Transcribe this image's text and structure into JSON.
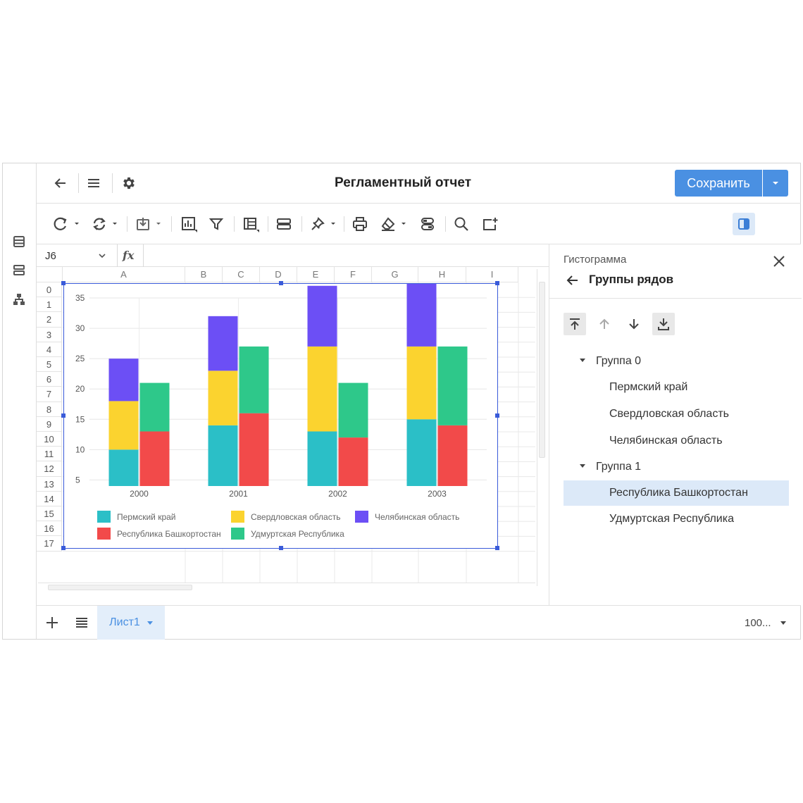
{
  "header": {
    "title": "Регламентный отчет",
    "save_label": "Сохранить"
  },
  "formula": {
    "cell_ref": "J6",
    "fx_label": "fx"
  },
  "columns": [
    "A",
    "B",
    "C",
    "D",
    "E",
    "F",
    "G",
    "H",
    "I"
  ],
  "rows": [
    "0",
    "1",
    "2",
    "3",
    "4",
    "5",
    "6",
    "7",
    "8",
    "9",
    "10",
    "11",
    "12",
    "13",
    "14",
    "15",
    "16",
    "17"
  ],
  "side_panel": {
    "section": "Гистограмма",
    "title": "Группы рядов",
    "tree": [
      {
        "label": "Группа 0",
        "type": "group"
      },
      {
        "label": "Пермский край",
        "type": "item"
      },
      {
        "label": "Свердловская область",
        "type": "item"
      },
      {
        "label": "Челябинская область",
        "type": "item"
      },
      {
        "label": "Группа 1",
        "type": "group"
      },
      {
        "label": "Республика Башкортостан",
        "type": "item",
        "selected": true
      },
      {
        "label": "Удмуртская Республика",
        "type": "item"
      }
    ]
  },
  "bottom": {
    "sheet_tab": "Лист1",
    "zoom": "100..."
  },
  "chart_data": {
    "type": "bar",
    "stacked": true,
    "categories": [
      "2000",
      "2001",
      "2002",
      "2003"
    ],
    "yticks": [
      5,
      10,
      15,
      20,
      25,
      30,
      35
    ],
    "ylim": [
      4,
      35
    ],
    "groups": [
      {
        "series": [
          {
            "name": "Пермский край",
            "color": "#2bbfc7",
            "values": [
              6,
              10,
              9,
              11
            ]
          },
          {
            "name": "Свердловская область",
            "color": "#fbd32f",
            "values": [
              8,
              9,
              14,
              12
            ]
          },
          {
            "name": "Челябинская область",
            "color": "#6c4ff5",
            "values": [
              7,
              9,
              10,
              11
            ]
          }
        ]
      },
      {
        "series": [
          {
            "name": "Республика Башкортостан",
            "color": "#f24a4a",
            "values": [
              9,
              12,
              8,
              10
            ]
          },
          {
            "name": "Удмуртская Республика",
            "color": "#2ec88a",
            "values": [
              8,
              11,
              9,
              13
            ]
          }
        ]
      }
    ],
    "legend": [
      {
        "name": "Пермский край",
        "color": "#2bbfc7"
      },
      {
        "name": "Свердловская область",
        "color": "#fbd32f"
      },
      {
        "name": "Челябинская область",
        "color": "#6c4ff5"
      },
      {
        "name": "Республика Башкортостан",
        "color": "#f24a4a"
      },
      {
        "name": "Удмуртская Республика",
        "color": "#2ec88a"
      }
    ],
    "legend_position": "bottom",
    "grid": true
  }
}
